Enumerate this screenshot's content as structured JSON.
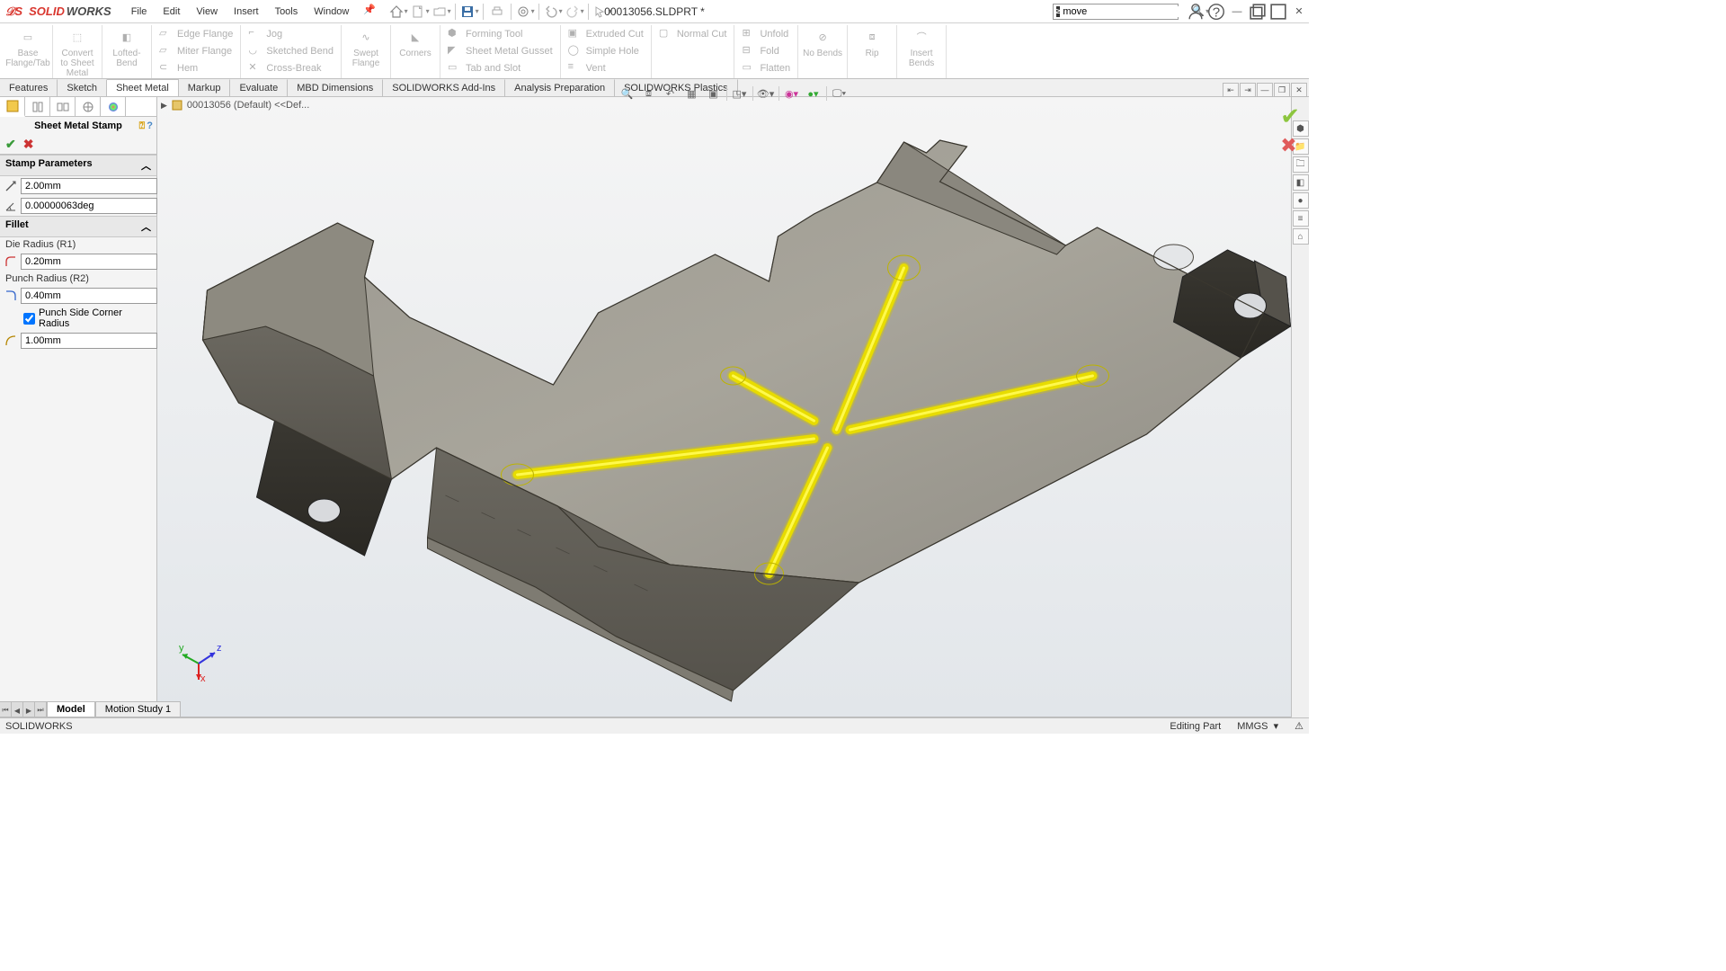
{
  "title": "00013056.SLDPRT *",
  "menus": [
    "File",
    "Edit",
    "View",
    "Insert",
    "Tools",
    "Window"
  ],
  "search": {
    "placeholder": "",
    "value": "move"
  },
  "ribbon": {
    "big1": "Base Flange/Tab",
    "big2": "Convert to Sheet Metal",
    "big3": "Lofted-Bend",
    "c1a": "Edge Flange",
    "c1b": "Miter Flange",
    "c1c": "Hem",
    "c2a": "Jog",
    "c2b": "Sketched Bend",
    "c2c": "Cross-Break",
    "big4": "Swept Flange",
    "big5": "Corners",
    "c3a": "Forming Tool",
    "c3b": "Sheet Metal Gusset",
    "c3c": "Tab and Slot",
    "c4a": "Extruded Cut",
    "c4b": "Simple Hole",
    "c4c": "Vent",
    "c5a": "Normal Cut",
    "c6a": "Unfold",
    "c6b": "Fold",
    "c6c": "Flatten",
    "big6": "No Bends",
    "big7": "Rip",
    "big8": "Insert Bends"
  },
  "cmdtabs": [
    "Features",
    "Sketch",
    "Sheet Metal",
    "Markup",
    "Evaluate",
    "MBD Dimensions",
    "SOLIDWORKS Add-Ins",
    "Analysis Preparation",
    "SOLIDWORKS Plastics"
  ],
  "cmdtab_active": 2,
  "pm": {
    "title": "Sheet Metal Stamp",
    "sec1": "Stamp Parameters",
    "depth": "2.00mm",
    "angle": "0.00000063deg",
    "sec2": "Fillet",
    "die_label": "Die Radius (R1)",
    "die": "0.20mm",
    "punch_label": "Punch Radius (R2)",
    "punch": "0.40mm",
    "corner_check": "Punch Side Corner Radius",
    "corner": "1.00mm"
  },
  "tree_crumb": "00013056 (Default) <<Def...",
  "btabs": [
    "Model",
    "Motion Study 1"
  ],
  "status_left": "SOLIDWORKS",
  "status_mode": "Editing Part",
  "status_units": "MMGS"
}
